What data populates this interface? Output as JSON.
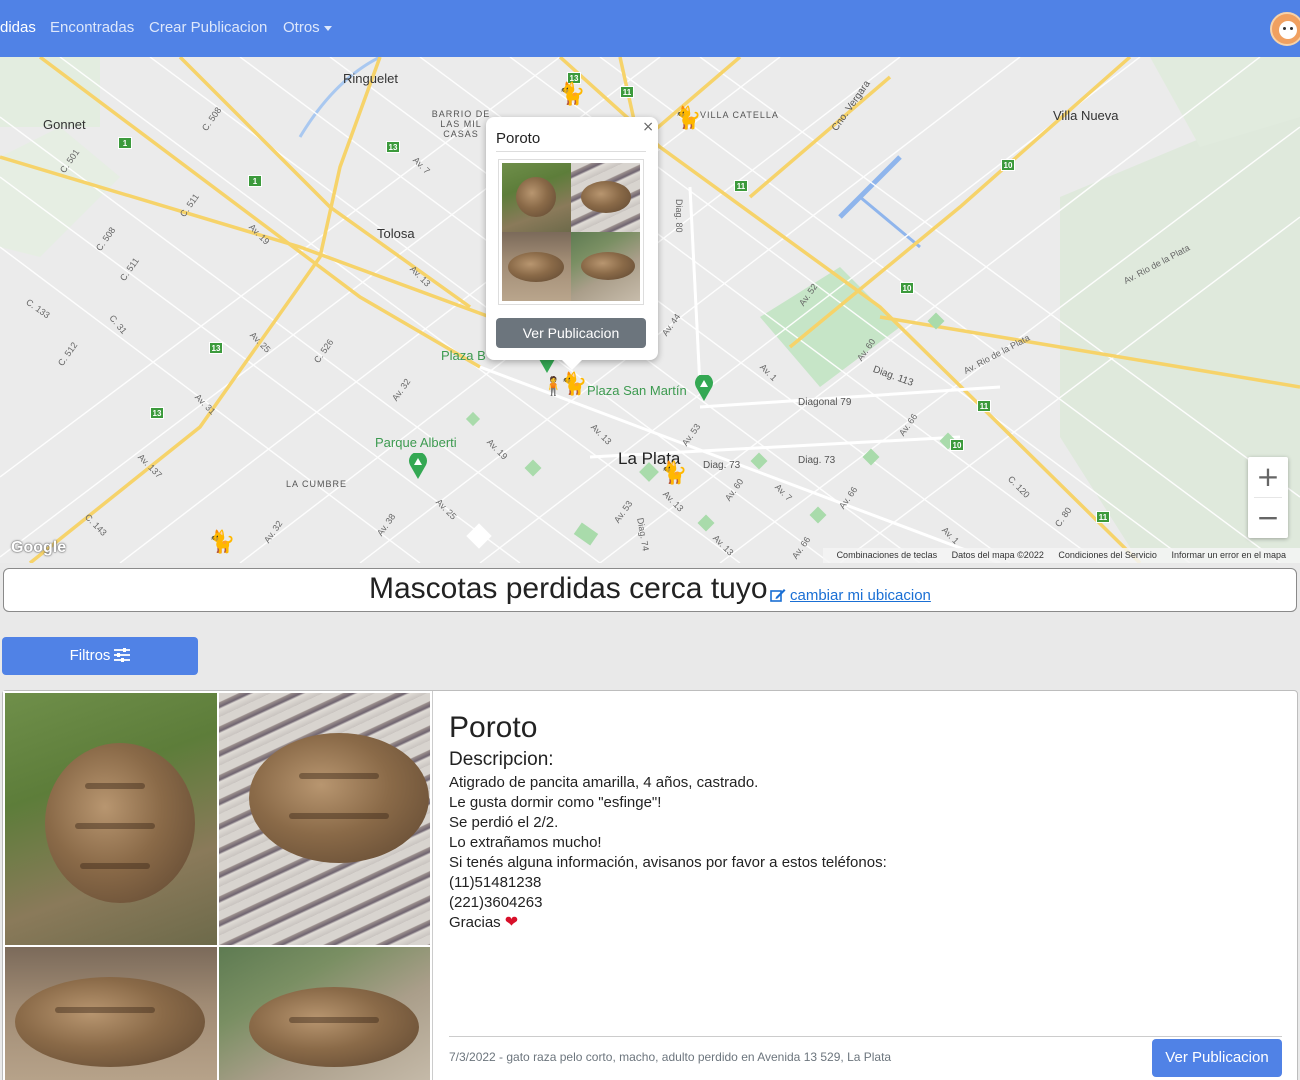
{
  "navbar": {
    "items": [
      {
        "label": "Perdidas",
        "visible_text": "didas",
        "active": true
      },
      {
        "label": "Encontradas"
      },
      {
        "label": "Crear Publicacion"
      },
      {
        "label": "Otros"
      }
    ],
    "avatar_icon": "penguin-avatar-icon",
    "color": "#5082e6"
  },
  "map": {
    "places": {
      "ringuelet": "Ringuelet",
      "gonnet": "Gonnet",
      "tolosa": "Tolosa",
      "villa_nueva": "Villa Nueva",
      "villa_catella": "VILLA CATELLA",
      "barrio_mil_casas": "BARRIO DE LAS MIL CASAS",
      "la_plata": "La Plata",
      "la_cumbre": "LA CUMBRE",
      "plaza_san_martin": "Plaza San Martín",
      "parque_alberti": "Parque Alberti",
      "plaza_b": "Plaza B",
      "diagonal_79": "Diagonal 79",
      "diag_73a": "Diag. 73",
      "diag_73b": "Diag. 73",
      "diag_113": "Diag. 113",
      "cno_vergara": "Cno. Vergara",
      "av_rio_plata_1": "Av. Rio de la Plata",
      "av_rio_plata_2": "Av. Rio de la Plata"
    },
    "roads": [
      "C. 508",
      "C. 501",
      "C. 511",
      "C. 508",
      "C. 511",
      "C. 133",
      "C. 31",
      "C. 512",
      "C. 526",
      "Av. 7",
      "Av. 19",
      "Av. 13",
      "Av. 25",
      "Av. 32",
      "Av. 31",
      "Av. 137",
      "C. 143",
      "Av. 32",
      "Av. 38",
      "Av. 25",
      "Av. 19",
      "Av. 13",
      "Av. 53",
      "Av. 44",
      "Av. 52",
      "Av. 60",
      "Av. 1",
      "Av. 66",
      "Av. 60",
      "Av. 7",
      "Av. 66",
      "Av. 53",
      "Av. 13",
      "Diag. 74",
      "Av. 13",
      "Av. 66",
      "Av. 1",
      "C. 120",
      "C. 80",
      "Diag. 80"
    ],
    "route_numbers": [
      "13",
      "11",
      "13",
      "1",
      "1",
      "11",
      "13",
      "13",
      "10",
      "10",
      "11",
      "10",
      "11"
    ],
    "zoom_in": "+",
    "zoom_out": "−",
    "google_logo": "Google",
    "footer": {
      "shortcuts": "Combinaciones de teclas",
      "data": "Datos del mapa ©2022",
      "terms": "Condiciones del Servicio",
      "report": "Informar un error en el mapa"
    },
    "infowindow": {
      "title": "Poroto",
      "close": "×",
      "button": "Ver Publicacion"
    }
  },
  "heading": {
    "text": "Mascotas perdidas cerca tuyo",
    "link": "cambiar mi ubicacion"
  },
  "filters": {
    "label": "Filtros"
  },
  "card": {
    "title": "Poroto",
    "subtitle": "Descripcion:",
    "description": [
      "Atigrado de pancita amarilla, 4 años, castrado.",
      "Le gusta dormir como \"esfinge\"!",
      "Se perdió el 2/2.",
      "Lo extrañamos mucho!",
      "Si tenés alguna información, avisanos por favor a estos teléfonos:",
      "(11)51481238",
      "(221)3604263",
      "Gracias"
    ],
    "meta": "7/3/2022 - gato raza pelo corto, macho, adulto perdido en Avenida 13 529, La Plata",
    "button": "Ver Publicacion"
  }
}
